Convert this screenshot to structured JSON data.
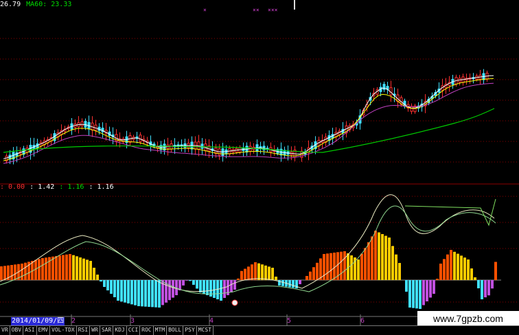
{
  "legend_top": {
    "ma_prev": {
      "value": "26.79",
      "color": "#ffffff"
    },
    "ma60": {
      "label": "MA60: 23.33",
      "color": "#00dd00"
    }
  },
  "markers": [
    "×",
    "××",
    "×××"
  ],
  "indicator_legend": {
    "v1": {
      "text": ": 0.00",
      "color": "#ff3030"
    },
    "v2": {
      "text": ": 1.42",
      "color": "#ffffff"
    },
    "v3": {
      "text": ": 1.16",
      "color": "#00dd00"
    },
    "v4": {
      "text": ": 1.16",
      "color": "#ffffff"
    }
  },
  "date_label": "2014/01/09/四",
  "xaxis_ticks": [
    "2",
    "3",
    "4",
    "5",
    "6"
  ],
  "tabs": [
    "VR",
    "OBV",
    "ASI",
    "EMV",
    "VOL-TDX",
    "RSI",
    "WR",
    "SAR",
    "KDJ",
    "CCI",
    "ROC",
    "MTM",
    "BOLL",
    "PSY",
    "MCST"
  ],
  "watermark": "www.7gpzb.com",
  "colors": {
    "up_candle": "#ff3030",
    "down_candle": "#40e0ff",
    "ma_short": "#ffffff",
    "ma_mid": "#ffff00",
    "ma_long": "#c040c0",
    "ma60": "#00cc00",
    "hist_pos_dark": "#ff5000",
    "hist_pos_light": "#ffcc00",
    "hist_neg_cyan": "#40e0ff",
    "hist_neg_magenta": "#c050e0",
    "grid": "#8b0000"
  }
}
